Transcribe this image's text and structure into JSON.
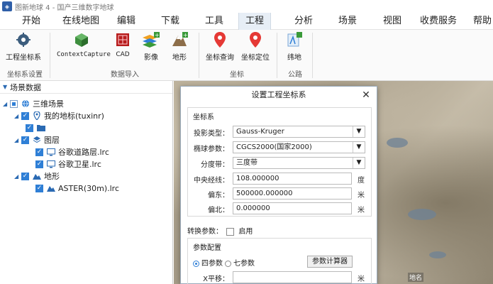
{
  "window": {
    "title": "图新地球 4 - 国产三维数字地球",
    "app_icon": "globe-app-icon"
  },
  "menu": [
    "开始",
    "在线地图",
    "编辑",
    "下载",
    "工具",
    "工程",
    "分析",
    "场景",
    "视图",
    "收费服务",
    "帮助"
  ],
  "menu_active": "工程",
  "ribbon": {
    "buttons": [
      {
        "label": "工程坐标系",
        "icon": "coordinate-system-icon"
      },
      {
        "label": "ContextCapture",
        "icon": "contextcapture-icon"
      },
      {
        "label": "CAD",
        "icon": "cad-icon"
      },
      {
        "label": "影像",
        "icon": "imagery-icon"
      },
      {
        "label": "地形",
        "icon": "terrain-icon"
      },
      {
        "label": "坐标查询",
        "icon": "location-pin-icon"
      },
      {
        "label": "坐标定位",
        "icon": "location-pin-icon"
      },
      {
        "label": "纬地",
        "icon": "road-design-icon"
      }
    ],
    "groups": [
      "坐标系设置",
      "数据导入",
      "坐标",
      "公路"
    ]
  },
  "panel": {
    "title": "场景数据",
    "tree": [
      {
        "label": "三维场景",
        "icon": "globe-icon"
      },
      {
        "label": "我的地标(tuxinr)",
        "icon": "placemark-icon"
      },
      {
        "label": "",
        "icon": "folder-icon"
      },
      {
        "label": "图层",
        "icon": "layers-icon"
      },
      {
        "label": "谷歌道路层.lrc",
        "icon": "monitor-icon"
      },
      {
        "label": "谷歌卫星.lrc",
        "icon": "monitor-icon"
      },
      {
        "label": "地形",
        "icon": "terrain-icon"
      },
      {
        "label": "ASTER(30m).lrc",
        "icon": "terrain-icon"
      }
    ]
  },
  "dialog": {
    "title": "设置工程坐标系",
    "close": "✕",
    "coord_section": "坐标系",
    "projection_label": "投影类型：",
    "projection_value": "Gauss-Kruger",
    "ellipsoid_label": "椭球参数：",
    "ellipsoid_value": "CGCS2000(国家2000)",
    "zone_label": "分度带：",
    "zone_value": "三度带",
    "meridian_label": "中央经线：",
    "meridian_value": "108.000000",
    "meridian_unit": "度",
    "false_east_label": "偏东：",
    "false_east_value": "500000.000000",
    "false_east_unit": "米",
    "false_north_label": "偏北：",
    "false_north_value": "0.000000",
    "false_north_unit": "米",
    "transform_label": "转换参数：",
    "transform_enable": "启用",
    "param_section": "参数配置",
    "four_param": "四参数",
    "seven_param": "七参数",
    "calc_button": "参数计算器",
    "x_shift_label": "X平移：",
    "x_shift_unit": "米"
  },
  "map": {
    "label": "地名"
  }
}
